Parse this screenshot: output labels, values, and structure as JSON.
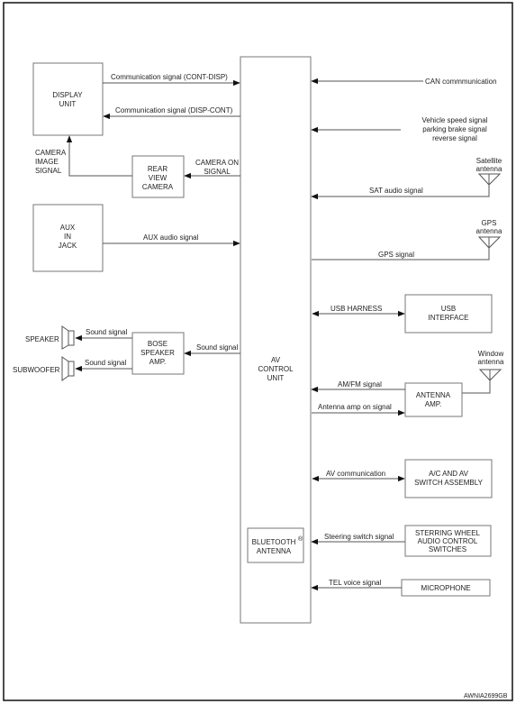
{
  "diagram": {
    "code": "AWNIA2699GB",
    "central_unit": {
      "lines": [
        "AV",
        "CONTROL",
        "UNIT"
      ]
    },
    "components": {
      "display_unit": [
        "DISPLAY",
        "UNIT"
      ],
      "rear_view_camera": [
        "REAR",
        "VIEW",
        "CAMERA"
      ],
      "aux_in_jack": [
        "AUX",
        "IN",
        "JACK"
      ],
      "bose_speaker_amp": [
        "BOSE",
        "SPEAKER",
        "AMP."
      ],
      "speaker": "SPEAKER",
      "subwoofer": "SUBWOOFER",
      "bluetooth_antenna": [
        "BLUETOOTH",
        "ANTENNA"
      ],
      "bluetooth_mark": "®",
      "usb_interface": [
        "USB",
        "INTERFACE"
      ],
      "antenna_amp": [
        "ANTENNA",
        "AMP."
      ],
      "ac_av_switch": [
        "A/C AND AV",
        "SWITCH ASSEMBLY"
      ],
      "steering_switches": [
        "STERRING WHEEL",
        "AUDIO CONTROL",
        "SWITCHES"
      ],
      "microphone": "MICROPHONE",
      "satellite_antenna": [
        "Satellite",
        "antenna"
      ],
      "gps_antenna": [
        "GPS",
        "antenna"
      ],
      "window_antenna": [
        "Window",
        "antenna"
      ]
    },
    "signals": {
      "cont_disp": "Communication signal (CONT-DISP)",
      "disp_cont": "Communication signal (DISP-CONT)",
      "camera_image": [
        "CAMERA",
        "IMAGE",
        "SIGNAL"
      ],
      "camera_on": [
        "CAMERA ON",
        "SIGNAL"
      ],
      "aux_audio": "AUX audio signal",
      "sound_speaker": "Sound signal",
      "sound_subwoofer": "Sound signal",
      "sound_amp": "Sound signal",
      "can": "CAN commmunication",
      "vehicle": [
        "Vehicle speed signal",
        "parking brake signal",
        "reverse signal"
      ],
      "sat_audio": "SAT audio signal",
      "gps": "GPS signal",
      "usb_harness": "USB HARNESS",
      "amfm": "AM/FM signal",
      "antenna_amp_on": "Antenna amp on signal",
      "av_comm": "AV communication",
      "steering": "Steering switch signal",
      "tel_voice": "TEL voice signal"
    }
  }
}
